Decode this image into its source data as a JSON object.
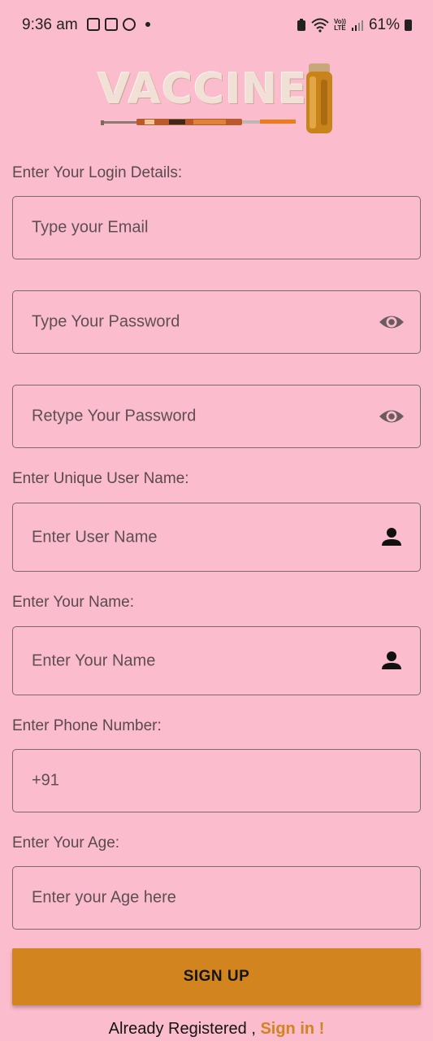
{
  "status_bar": {
    "time": "9:36 am",
    "battery": "61%",
    "lte_top": "Vo))",
    "lte_bottom": "LTE"
  },
  "logo": {
    "text": "VACCINE"
  },
  "form": {
    "login_label": "Enter Your Login Details:",
    "email_placeholder": "Type your Email",
    "password_placeholder": "Type Your Password",
    "retype_password_placeholder": "Retype Your Password",
    "username_label": "Enter Unique User Name:",
    "username_placeholder": "Enter User Name",
    "name_label": "Enter Your Name:",
    "name_placeholder": "Enter Your Name",
    "phone_label": "Enter Phone Number:",
    "phone_value": "+91",
    "age_label": "Enter Your Age:",
    "age_placeholder": "Enter your Age here"
  },
  "signup_button": "SIGN UP",
  "footer": {
    "text": "Already Registered , ",
    "link": "Sign in !"
  },
  "colors": {
    "background": "#fbbccd",
    "accent": "#d2841e"
  }
}
